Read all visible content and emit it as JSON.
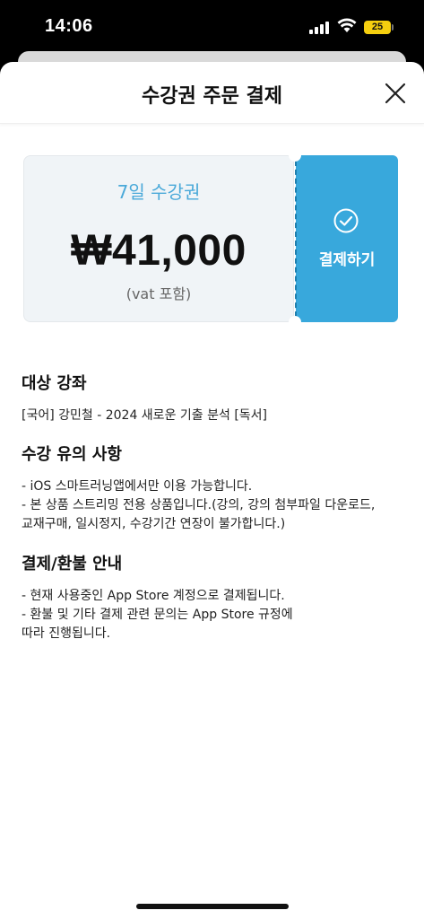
{
  "status_bar": {
    "time": "14:06",
    "battery": "25"
  },
  "header": {
    "title": "수강권 주문 결제"
  },
  "ticket": {
    "pass_name": "7일 수강권",
    "price": "₩41,000",
    "vat_note": "(vat 포함)",
    "pay_label": "결제하기",
    "accent_color": "#38a8dc"
  },
  "sections": [
    {
      "title": "대상 강좌",
      "lines": [
        "[국어] 강민철 - 2024 새로운 기출 분석 [독서]"
      ]
    },
    {
      "title": "수강 유의 사항",
      "lines": [
        "- iOS 스마트러닝앱에서만 이용 가능합니다.",
        "- 본 상품 스트리밍 전용 상품입니다.(강의, 강의 첨부파일 다운로드,",
        "교재구매, 일시정지, 수강기간 연장이 불가합니다.)"
      ]
    },
    {
      "title": "결제/환불 안내",
      "lines": [
        "- 현재 사용중인 App Store 계정으로 결제됩니다.",
        "- 환불 및 기타 결제 관련 문의는 App Store 규정에",
        "따라 진행됩니다."
      ]
    }
  ]
}
